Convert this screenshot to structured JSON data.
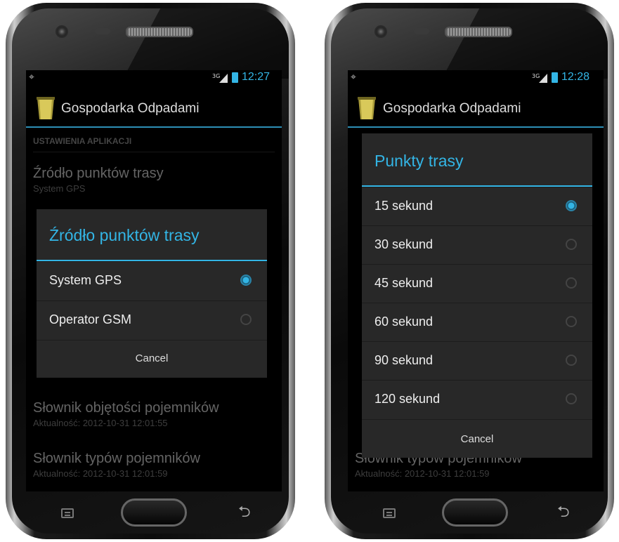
{
  "left": {
    "status": {
      "network": "3G",
      "time": "12:27"
    },
    "app_title": "Gospodarka Odpadami",
    "category": "USTAWIENIA APLIKACJI",
    "pref_source": {
      "title": "Źródło punktów trasy",
      "summary": "System GPS"
    },
    "dialog": {
      "title": "Źródło punktów trasy",
      "options": [
        {
          "label": "System GPS",
          "selected": true
        },
        {
          "label": "Operator GSM",
          "selected": false
        }
      ],
      "cancel": "Cancel"
    },
    "pref_volume": {
      "title": "Słownik objętości pojemników",
      "summary": "Aktualność: 2012-10-31 12:01:55"
    },
    "pref_types": {
      "title": "Słownik typów pojemników",
      "summary": "Aktualność: 2012-10-31 12:01:59"
    }
  },
  "right": {
    "status": {
      "network": "3G",
      "time": "12:28"
    },
    "app_title": "Gospodarka Odpadami",
    "dialog": {
      "title": "Punkty trasy",
      "options": [
        {
          "label": "15 sekund",
          "selected": true
        },
        {
          "label": "30 sekund",
          "selected": false
        },
        {
          "label": "45 sekund",
          "selected": false
        },
        {
          "label": "60 sekund",
          "selected": false
        },
        {
          "label": "90 sekund",
          "selected": false
        },
        {
          "label": "120 sekund",
          "selected": false
        }
      ],
      "cancel": "Cancel"
    },
    "pref_types": {
      "title": "Słownik typów pojemników",
      "summary": "Aktualność: 2012-10-31 12:01:59"
    }
  },
  "colors": {
    "accent": "#33b5e5",
    "dialog_bg": "#282828",
    "screen_bg": "#000000"
  }
}
